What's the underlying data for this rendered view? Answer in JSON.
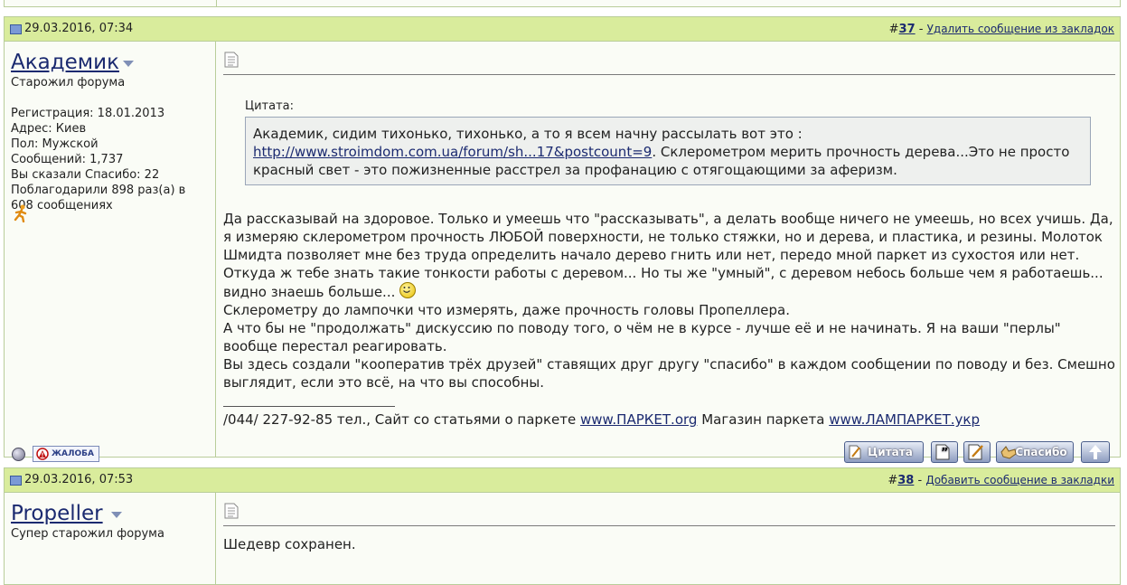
{
  "posts": [
    {
      "date": "29.03.2016, 07:34",
      "number_prefix": "#",
      "number": "37",
      "action_sep": " - ",
      "action": "Удалить сообщение из закладок",
      "user": {
        "name": "Академик",
        "rank": "Старожил форума",
        "stats": [
          "Регистрация: 18.01.2013",
          "Адрес: Киев",
          "Пол: Мужской",
          "Сообщений: 1,737",
          "Вы сказали Спасибо: 22",
          "Поблагодарили 898 раз(а) в 608 сообщениях"
        ]
      },
      "quote": {
        "label": "Цитата:",
        "line1": "Академик, сидим тихонько, тихонько, а то я всем начну рассылать вот это :",
        "link": "http://www.stroimdom.com.ua/forum/sh...17&postcount=9",
        "after_link": ". Склерометром мерить прочность дерева...Это не просто красный свет - это пожизненные расстрел за профанацию с отягощающими за аферизм."
      },
      "message": {
        "p1": "Да рассказывай на здоровое. Только и умеешь что \"рассказывать\", а делать вообще ничего не умеешь, но всех учишь. Да, я измеряю склерометром прочность ЛЮБОЙ поверхности, не только стяжки, но и дерева, и пластика, и резины. Молоток Шмидта позволяет мне без труда определить начало дерево гнить или нет, передо мной паркет из сухостоя или нет. Откуда ж тебе знать такие тонкости работы с деревом... Но ты же \"умный\", с деревом небось больше чем я работаешь... видно знаешь больше...",
        "p2": "Склерометру до лампочки что измерять, даже прочность головы Пропеллера.",
        "p3": "А что бы не \"продолжать\" дискуссию по поводу того, о чём не в курсе - лучше её и не начинать. Я на ваши \"перлы\" вообще перестал реагировать.",
        "p4": "Вы здесь создали \"кооператив трёх друзей\" ставящих друг другу \"спасибо\" в каждом сообщении по поводу и без. Смешно выглядит, если это всё, на что вы способны."
      },
      "signature": {
        "phone": "/044/ 227-92-85 тел., Сайт со статьями о паркете ",
        "link1": "www.ПАРКЕТ.org",
        "mid": " Магазин паркета ",
        "link2": "www.ЛАМПАРКЕТ.укр"
      },
      "report_label": "ЖАЛОБА",
      "buttons": {
        "quote": "Цитата",
        "thanks": "Спасибо"
      }
    },
    {
      "date": "29.03.2016, 07:53",
      "number_prefix": "#",
      "number": "38",
      "action_sep": " - ",
      "action": "Добавить сообщение в закладки",
      "user": {
        "name": "Propeller",
        "rank": "Супер старожил форума"
      },
      "message": {
        "p1": "Шедевр сохранен."
      }
    }
  ],
  "icons": [
    "post-status-icon",
    "user-menu-arrow-icon",
    "online-status-icon",
    "warning-icon",
    "document-icon",
    "smiley-icon",
    "runner-icon",
    "multiquote-icon",
    "edit-icon",
    "thanks-icon",
    "scroll-top-icon"
  ],
  "colors": {
    "header_bg": "#d9ec9c",
    "border": "#b9cd9a",
    "link": "#1b2a70",
    "quote_bg": "#eef0ee"
  }
}
